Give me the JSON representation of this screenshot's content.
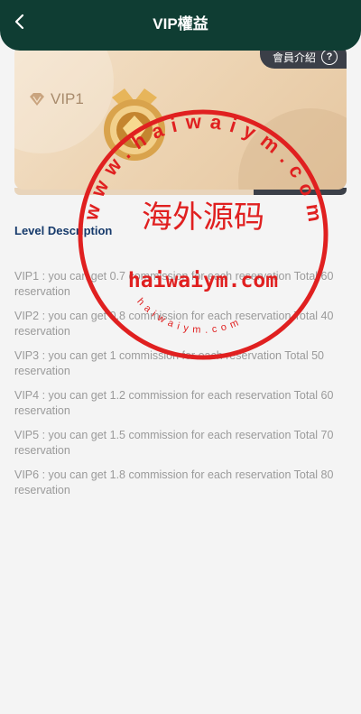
{
  "header": {
    "title": "VIP權益"
  },
  "card": {
    "member_intro_label": "會員介紹",
    "help_symbol": "?",
    "vip_level": "VIP1"
  },
  "section": {
    "title": "Level Description"
  },
  "levels": [
    {
      "text": "VIP1 : you can get 0.7 commission for each reservation Total 60 reservation"
    },
    {
      "text": "VIP2 : you can get 0.8 commission for each reservation Total 40 reservation"
    },
    {
      "text": "VIP3 : you can get 1 commission for each reservation Total 50 reservation"
    },
    {
      "text": "VIP4 : you can get 1.2 commission for each reservation Total 60 reservation"
    },
    {
      "text": "VIP5 : you can get 1.5 commission for each reservation Total 70 reservation"
    },
    {
      "text": "VIP6 : you can get 1.8 commission for each reservation Total 80 reservation"
    }
  ],
  "watermark": {
    "center_text": "海外源码",
    "main_text": "haiwaiym.com",
    "ring_text": "www.haiwaiym.com",
    "small_ring_text": "haiwaiym.com"
  },
  "colors": {
    "header_bg": "#0f3d33",
    "card_gold": "#ecd2b0",
    "section_title": "#163a6b",
    "body_text": "#9a9a9a",
    "watermark_red": "#e02020"
  },
  "icons": {
    "back": "chevron-left-icon",
    "help": "question-circle-icon",
    "vip": "diamond-icon",
    "medal": "medal-icon"
  }
}
